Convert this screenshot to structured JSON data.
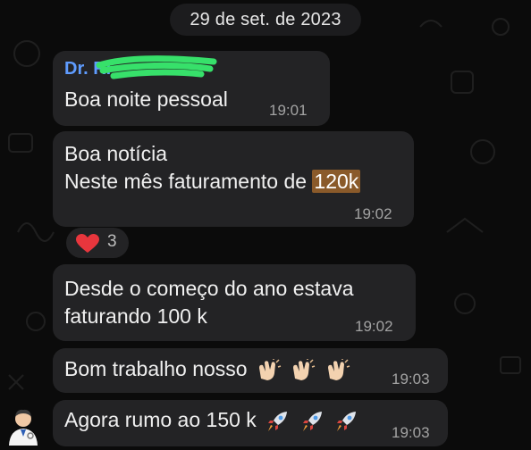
{
  "chat": {
    "date": "29 de set. de 2023",
    "messages": [
      {
        "sender": "Dr. Ri",
        "lines": [
          "Boa noite pessoal"
        ],
        "time": "19:01"
      },
      {
        "lines": [
          "Boa notícia",
          "Neste mês faturamento de "
        ],
        "highlight": "120k",
        "time": "19:02"
      },
      {
        "lines": [
          "Desde o começo do ano estava",
          "faturando 100 k"
        ],
        "time": "19:02"
      },
      {
        "lines": [
          "Bom trabalho nosso"
        ],
        "time": "19:03"
      },
      {
        "lines": [
          "Agora rumo ao 150 k"
        ],
        "time": "19:03"
      }
    ],
    "reaction": {
      "emoji": "heart-icon",
      "count": "3"
    }
  },
  "colors": {
    "background": "#0b0b0b",
    "bubble": "#232325",
    "sender": "#5f9cff",
    "highlight": "#8a5a2a",
    "scribble": "#37e06a"
  }
}
